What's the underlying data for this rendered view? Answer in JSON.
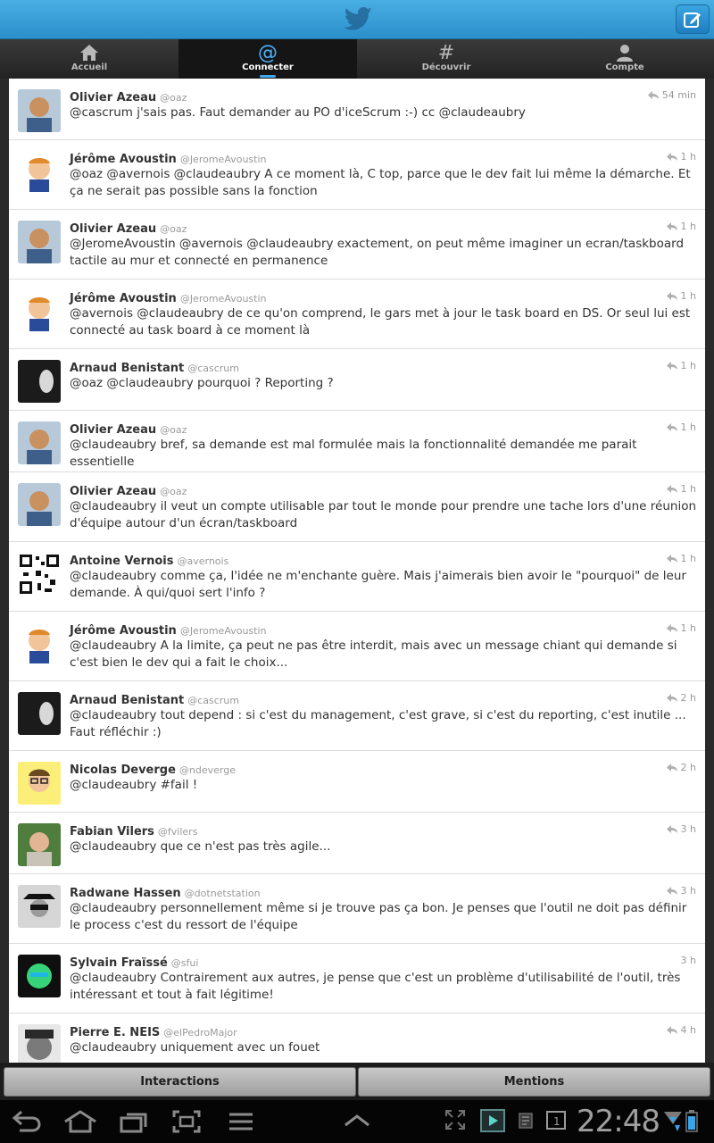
{
  "tabs": [
    {
      "label": "Accueil",
      "icon": "home-icon"
    },
    {
      "label": "Connecter",
      "icon": "at-icon"
    },
    {
      "label": "Découvrir",
      "icon": "hash-icon"
    },
    {
      "label": "Compte",
      "icon": "person-icon"
    }
  ],
  "tweets": [
    {
      "name": "Olivier Azeau",
      "handle": "@oaz",
      "time": "54 min",
      "text": "@cascrum j'sais pas. Faut demander au PO d'iceScrum :-) cc @claudeaubry"
    },
    {
      "name": "Jérôme Avoustin",
      "handle": "@JeromeAvoustin",
      "time": "1 h",
      "text": "@oaz @avernois @claudeaubry A ce moment là, C top, parce que le dev fait lui même la démarche. Et ça ne serait pas possible sans la fonction"
    },
    {
      "name": "Olivier Azeau",
      "handle": "@oaz",
      "time": "1 h",
      "text": "@JeromeAvoustin @avernois @claudeaubry exactement, on peut même imaginer un ecran/taskboard tactile au mur et connecté en permanence"
    },
    {
      "name": "Jérôme Avoustin",
      "handle": "@JeromeAvoustin",
      "time": "1 h",
      "text": "@avernois @claudeaubry de ce qu'on comprend, le gars met à jour le task board en DS. Or seul lui est connecté au task board à ce moment là"
    },
    {
      "name": "Arnaud Benistant",
      "handle": "@cascrum",
      "time": "1 h",
      "text": "@oaz @claudeaubry pourquoi ? Reporting ?"
    },
    {
      "name": "Olivier Azeau",
      "handle": "@oaz",
      "time": "1 h",
      "text": "@claudeaubry bref, sa demande est mal formulée mais la fonctionnalité demandée me parait essentielle"
    },
    {
      "name": "Olivier Azeau",
      "handle": "@oaz",
      "time": "1 h",
      "text": "@claudeaubry il veut un compte utilisable par tout le monde pour prendre une tache lors d'une réunion d'équipe autour d'un écran/taskboard"
    },
    {
      "name": "Antoine Vernois",
      "handle": "@avernois",
      "time": "1 h",
      "text": "@claudeaubry comme ça, l'idée ne m'enchante guère. Mais j'aimerais bien avoir le \"pourquoi\" de leur demande. À qui/quoi sert l'info ?"
    },
    {
      "name": "Jérôme Avoustin",
      "handle": "@JeromeAvoustin",
      "time": "1 h",
      "text": "@claudeaubry A la limite, ça peut ne pas être interdit, mais avec un message chiant qui demande si c'est bien le dev qui a fait le choix..."
    },
    {
      "name": "Arnaud Benistant",
      "handle": "@cascrum",
      "time": "2 h",
      "text": "@claudeaubry tout depend : si c'est du management, c'est grave, si c'est du reporting, c'est inutile ... Faut réfléchir :)"
    },
    {
      "name": "Nicolas Deverge",
      "handle": "@ndeverge",
      "time": "2 h",
      "text": "@claudeaubry #fail !"
    },
    {
      "name": "Fabian Vilers",
      "handle": "@fvilers",
      "time": "3 h",
      "text": "@claudeaubry que ce n'est pas très agile..."
    },
    {
      "name": "Radwane Hassen",
      "handle": "@dotnetstation",
      "time": "3 h",
      "text": "@claudeaubry personnellement même si je trouve pas ça bon. Je penses que l'outil ne doit pas définir le process c'est du ressort de l'équipe"
    },
    {
      "name": "Sylvain Fraïssé",
      "handle": "@sfui",
      "time": "3 h",
      "text": "@claudeaubry Contrairement aux autres, je pense que c'est un problème d'utilisabilité de l'outil, très intéressant et tout à fait légitime!"
    },
    {
      "name": "Pierre E. NEIS",
      "handle": "@elPedroMajor",
      "time": "4 h",
      "text": "@claudeaubry uniquement avec un fouet"
    }
  ],
  "bottom": {
    "interactions": "Interactions",
    "mentions": "Mentions"
  },
  "status": {
    "clock": "22:48"
  }
}
